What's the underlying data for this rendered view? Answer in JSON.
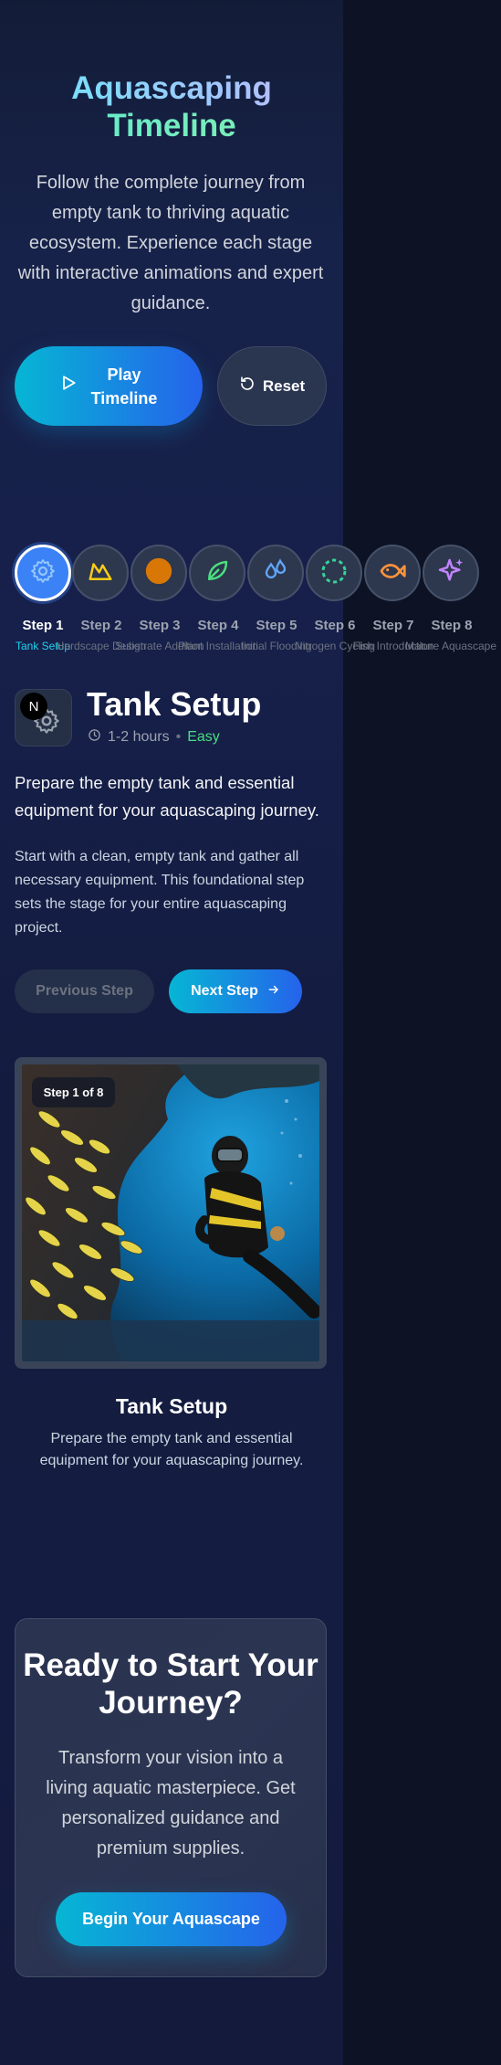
{
  "hero": {
    "title_line1": "Aquascaping",
    "title_line2": "Timeline",
    "description": "Follow the complete journey from empty tank to thriving aquatic ecosystem. Experience each stage with interactive animations and expert guidance.",
    "play_label": "Play Timeline",
    "reset_label": "Reset"
  },
  "steps": [
    {
      "num": "Step 1",
      "name": "Tank Setup",
      "icon": "gear-icon",
      "color": "#60a5fa",
      "active": true
    },
    {
      "num": "Step 2",
      "name": "Hardscape Design",
      "icon": "mountain-icon",
      "color": "#facc15"
    },
    {
      "num": "Step 3",
      "name": "Substrate Addition",
      "icon": "substrate-circle-icon",
      "color": "#d97706"
    },
    {
      "num": "Step 4",
      "name": "Plant Installation",
      "icon": "leaf-icon",
      "color": "#4ade80"
    },
    {
      "num": "Step 5",
      "name": "Initial Flooding",
      "icon": "droplets-icon",
      "color": "#60a5fa"
    },
    {
      "num": "Step 6",
      "name": "Nitrogen Cycling",
      "icon": "cycle-dashed-icon",
      "color": "#34d399"
    },
    {
      "num": "Step 7",
      "name": "Fish Introduction",
      "icon": "fish-icon",
      "color": "#fb923c"
    },
    {
      "num": "Step 8",
      "name": "Mature Aquascape",
      "icon": "sparkles-icon",
      "color": "#c084fc"
    }
  ],
  "detail": {
    "badge": "N",
    "title": "Tank Setup",
    "duration": "1-2 hours",
    "separator": "•",
    "difficulty": "Easy",
    "lead": "Prepare the empty tank and essential equipment for your aquascaping journey.",
    "body": "Start with a clean, empty tank and gather all necessary equipment. This foundational step sets the stage for your entire aquascaping project.",
    "prev_label": "Previous Step",
    "next_label": "Next Step"
  },
  "image_card": {
    "badge": "Step 1 of 8",
    "caption_title": "Tank Setup",
    "caption_desc": "Prepare the empty tank and essential equipment for your aquascaping journey."
  },
  "cta": {
    "title": "Ready to Start Your Journey?",
    "description": "Transform your vision into a living aquatic masterpiece. Get personalized guidance and premium supplies.",
    "button_label": "Begin Your Aquascape"
  },
  "colors": {
    "accent_cyan": "#06b6d4",
    "accent_blue": "#2563eb",
    "easy_green": "#4ade80"
  }
}
